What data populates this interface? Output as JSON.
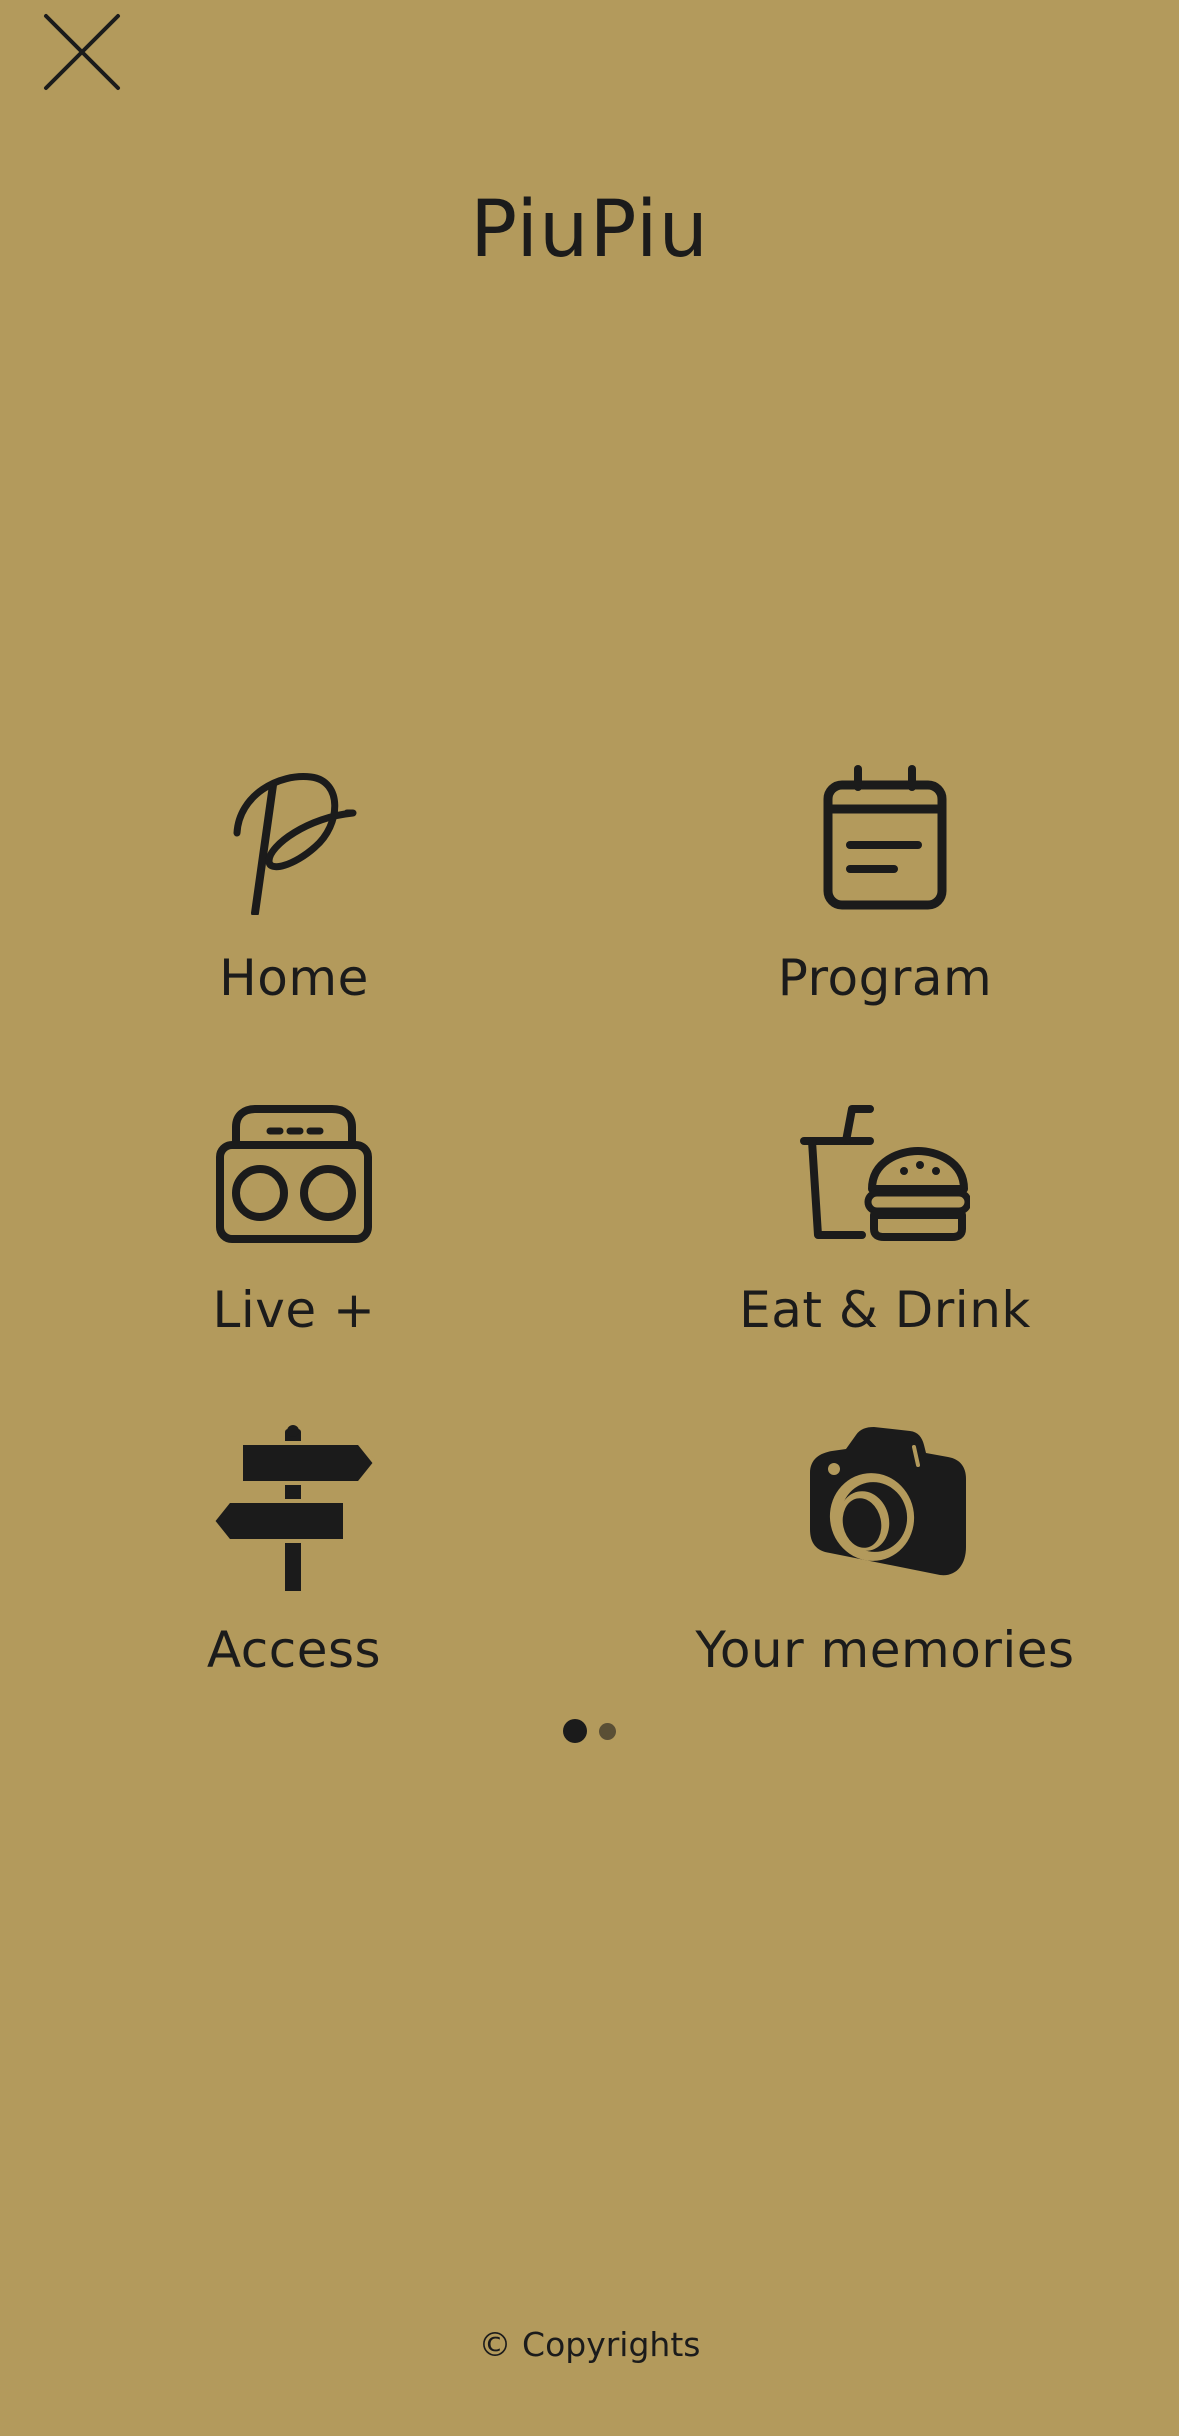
{
  "header": {
    "close_icon": "close-icon",
    "title": "PiuPiu"
  },
  "menu": {
    "items": [
      {
        "label": "Home",
        "icon": "p-logo-icon"
      },
      {
        "label": "Program",
        "icon": "calendar-icon"
      },
      {
        "label": "Live +",
        "icon": "boombox-icon"
      },
      {
        "label": "Eat & Drink",
        "icon": "drink-burger-icon"
      },
      {
        "label": "Access",
        "icon": "signpost-icon"
      },
      {
        "label": "Your memories",
        "icon": "camera-icon"
      }
    ]
  },
  "pager": {
    "current_page": 1,
    "total_pages": 2
  },
  "footer": {
    "copyright": "© Copyrights"
  },
  "colors": {
    "background": "#b39a5c",
    "foreground": "#1b1b1b",
    "inactive_dot": "#5a4f35"
  }
}
